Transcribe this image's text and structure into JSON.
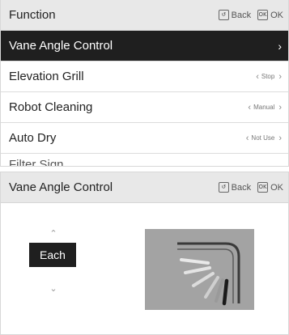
{
  "function_panel": {
    "title": "Function",
    "back_label": "Back",
    "ok_label": "OK",
    "items": [
      {
        "label": "Vane Angle Control",
        "value": "",
        "selected": true
      },
      {
        "label": "Elevation Grill",
        "value": "Stop"
      },
      {
        "label": "Robot Cleaning",
        "value": "Manual"
      },
      {
        "label": "Auto Dry",
        "value": "Not Use"
      },
      {
        "label": "Filter Sign",
        "value": ""
      }
    ]
  },
  "vane_panel": {
    "title": "Vane Angle Control",
    "back_label": "Back",
    "ok_label": "OK",
    "mode_value": "Each"
  },
  "icons": {
    "back": "back-icon",
    "ok": "ok-icon",
    "up": "chevron-up-icon",
    "down": "chevron-down-icon"
  },
  "colors": {
    "header_bg": "#e8e8e8",
    "selected_bg": "#1f1f1f",
    "preview_bg": "#a3a3a3"
  }
}
